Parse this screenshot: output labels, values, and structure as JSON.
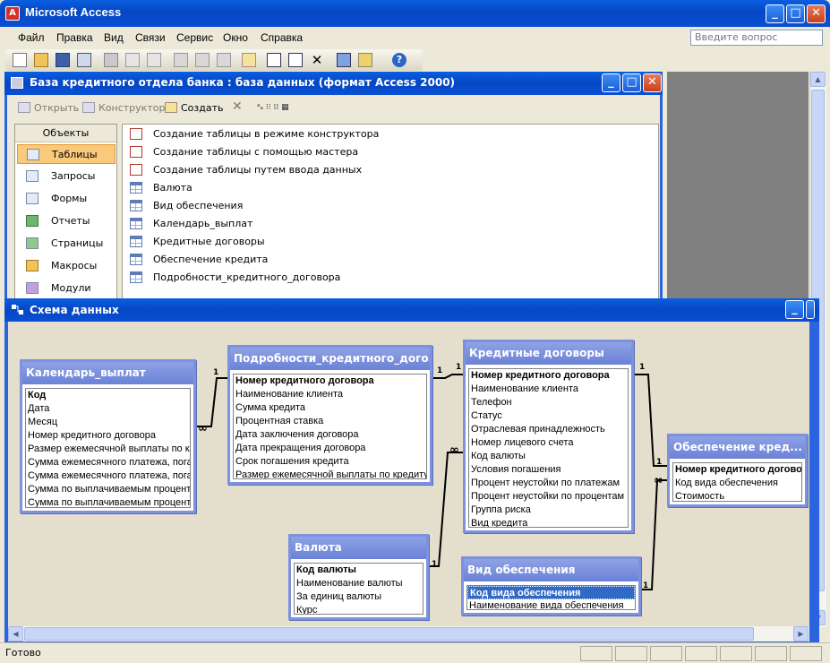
{
  "app": {
    "title": "Microsoft Access",
    "help_placeholder": "Введите вопрос"
  },
  "menu": [
    "Файл",
    "Правка",
    "Вид",
    "Связи",
    "Сервис",
    "Окно",
    "Справка"
  ],
  "db_window": {
    "title": "База кредитного отдела банка : база данных (формат Access 2000)",
    "toolbar": {
      "open": "Открыть",
      "design": "Конструктор",
      "create": "Создать"
    },
    "objects_header": "Объекты",
    "objects": [
      "Таблицы",
      "Запросы",
      "Формы",
      "Отчеты",
      "Страницы",
      "Макросы",
      "Модули"
    ],
    "selected_object": "Таблицы",
    "items": [
      "Создание таблицы в режиме конструктора",
      "Создание таблицы с помощью мастера",
      "Создание таблицы путем ввода данных",
      "Валюта",
      "Вид обеспечения",
      "Календарь_выплат",
      "Кредитные договоры",
      "Обеспечение кредита",
      "Подробности_кредитного_договора"
    ]
  },
  "schema": {
    "title": "Схема данных",
    "tables": {
      "calendar": {
        "title": "Календарь_выплат",
        "fields": [
          "Код",
          "Дата",
          "Месяц",
          "Номер кредитного договора",
          "Размер ежемесячной выплаты по кре",
          "Сумма ежемесячного платежа, погаш",
          "Сумма ежемесячного платежа, погаш",
          "Сумма по выплачиваемым процентам",
          "Сумма по выплачиваемым процентам"
        ]
      },
      "details": {
        "title": "Подробности_кредитного_дого...",
        "fields": [
          "Номер кредитного договора",
          "Наименование клиента",
          "Сумма кредита",
          "Процентная ставка",
          "Дата заключения договора",
          "Дата прекращения договора",
          "Срок погашения кредита",
          "Размер ежемесячной выплаты по кредиту"
        ]
      },
      "contracts": {
        "title": "Кредитные договоры",
        "fields": [
          "Номер кредитного договора",
          "Наименование клиента",
          "Телефон",
          "Статус",
          "Отраслевая принадлежность",
          "Номер лицевого счета",
          "Код валюты",
          "Условия погашения",
          "Процент неустойки по платежам",
          "Процент неустойки по процентам",
          "Группа риска",
          "Вид кредита"
        ]
      },
      "security": {
        "title": "Обеспечение кред...",
        "fields": [
          "Номер кредитного договора",
          "Код вида обеспечения",
          "Стоимость"
        ]
      },
      "currency": {
        "title": "Валюта",
        "fields": [
          "Код  валюты",
          "Наименование валюты",
          "За единиц валюты",
          "Курс"
        ]
      },
      "sectype": {
        "title": "Вид обеспечения",
        "fields": [
          "Код вида обеспечения",
          "Наименование вида обеспечения"
        ]
      }
    },
    "rel_one": "1",
    "rel_many": "∞"
  },
  "status": {
    "text": "Готово"
  }
}
